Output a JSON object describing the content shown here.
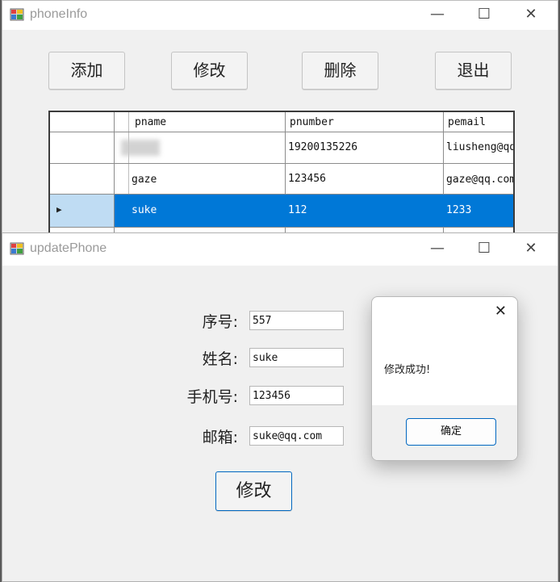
{
  "main_window": {
    "title": "phoneInfo",
    "buttons": {
      "add": "添加",
      "edit": "修改",
      "delete": "删除",
      "exit": "退出"
    },
    "grid": {
      "columns": [
        "pname",
        "pnumber",
        "pemail"
      ],
      "rows": [
        {
          "pname": "",
          "pnumber": "19200135226",
          "pemail": "liusheng@qq"
        },
        {
          "pname": "gaze",
          "pnumber": "123456",
          "pemail": "gaze@qq.com"
        },
        {
          "pname": "suke",
          "pnumber": "112",
          "pemail": "1233"
        }
      ],
      "row_indicator": "▶"
    }
  },
  "update_window": {
    "title": "updatePhone",
    "labels": {
      "id": "序号:",
      "name": "姓名:",
      "phone": "手机号:",
      "email": "邮箱:"
    },
    "values": {
      "id": "557",
      "name": "suke",
      "phone": "123456",
      "email": "suke@qq.com"
    },
    "submit": "修改"
  },
  "message_box": {
    "message": "修改成功!",
    "ok": "确定",
    "close": "✕"
  },
  "caption": {
    "minimize": "—",
    "maximize": "☐",
    "close": "✕"
  },
  "colors": {
    "selection": "#0078d7",
    "ok_border": "#0067c0"
  }
}
